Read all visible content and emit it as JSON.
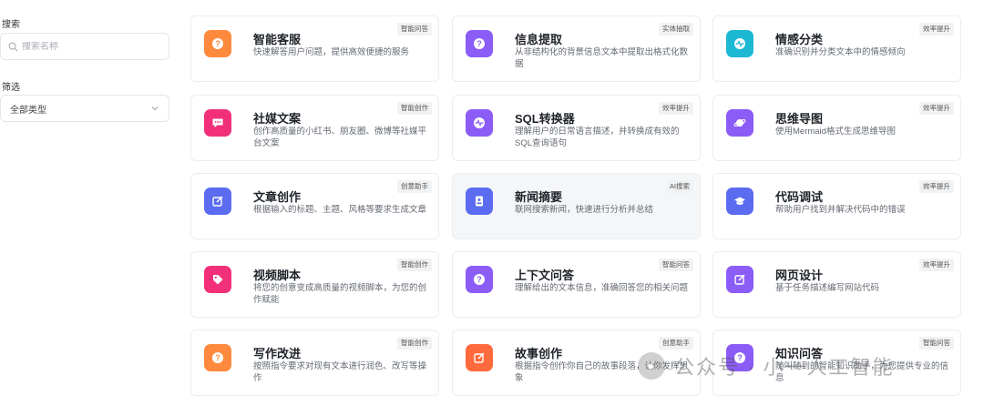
{
  "sidebar": {
    "search_label": "搜索",
    "search_placeholder": "搜索名称",
    "search_value": "",
    "filter_label": "筛选",
    "filter_value": "全部类型"
  },
  "cards": [
    {
      "title": "智能客服",
      "desc": "快速解答用户问题，提供高效便捷的服务",
      "tag": "智能问答",
      "icon": "question-icon",
      "color": "#ff8a3d"
    },
    {
      "title": "信息提取",
      "desc": "从非结构化的背景信息文本中提取出格式化数据",
      "tag": "实体抽取",
      "icon": "question-icon",
      "color": "#8b5cf6"
    },
    {
      "title": "情感分类",
      "desc": "准确识别并分类文本中的情感倾向",
      "tag": "效率提升",
      "icon": "pulse-icon",
      "color": "#1cb8d4"
    },
    {
      "title": "社媒文案",
      "desc": "创作高质量的小红书、朋友圈、微博等社媒平台文案",
      "tag": "智能创作",
      "icon": "chat-icon",
      "color": "#f2307a"
    },
    {
      "title": "SQL转换器",
      "desc": "理解用户的日常语言描述，并转换成有效的SQL查询语句",
      "tag": "效率提升",
      "icon": "pulse-icon",
      "color": "#8b5cf6"
    },
    {
      "title": "思维导图",
      "desc": "使用Mermaid格式生成思维导图",
      "tag": "效率提升",
      "icon": "planet-icon",
      "color": "#8b5cf6"
    },
    {
      "title": "文章创作",
      "desc": "根据输入的标题、主题、风格等要求生成文章",
      "tag": "创意助手",
      "icon": "edit-icon",
      "color": "#5b6cf0"
    },
    {
      "title": "新闻摘要",
      "desc": "联网搜索新闻，快速进行分析并总结",
      "tag": "AI搜索",
      "icon": "id-card-icon",
      "color": "#5b6cf0"
    },
    {
      "title": "代码调试",
      "desc": "帮助用户找到并解决代码中的错误",
      "tag": "效率提升",
      "icon": "graduation-cap-icon",
      "color": "#5b6cf0"
    },
    {
      "title": "视频脚本",
      "desc": "将您的创意变成高质量的视频脚本，为您的创作赋能",
      "tag": "智能创作",
      "icon": "tag-icon",
      "color": "#f2307a"
    },
    {
      "title": "上下文问答",
      "desc": "理解给出的文本信息，准确回答您的相关问题",
      "tag": "智能问答",
      "icon": "question-icon",
      "color": "#8b5cf6"
    },
    {
      "title": "网页设计",
      "desc": "基于任务描述编写网站代码",
      "tag": "效率提升",
      "icon": "edit-icon",
      "color": "#8b5cf6"
    },
    {
      "title": "写作改进",
      "desc": "按照指令要求对现有文本进行润色、改写等操作",
      "tag": "智能创作",
      "icon": "question-icon",
      "color": "#ff8a3d"
    },
    {
      "title": "故事创作",
      "desc": "根据指令创作你自己的故事段落，让你发挥想象",
      "tag": "创意助手",
      "icon": "edit-icon",
      "color": "#ff6a3d"
    },
    {
      "title": "知识问答",
      "desc": "随叫随到的智能知识助手，为您提供专业的信息",
      "tag": "智能问答",
      "icon": "question-icon",
      "color": "#8b5cf6"
    }
  ],
  "watermark": "公众号 · 小一人工智能"
}
